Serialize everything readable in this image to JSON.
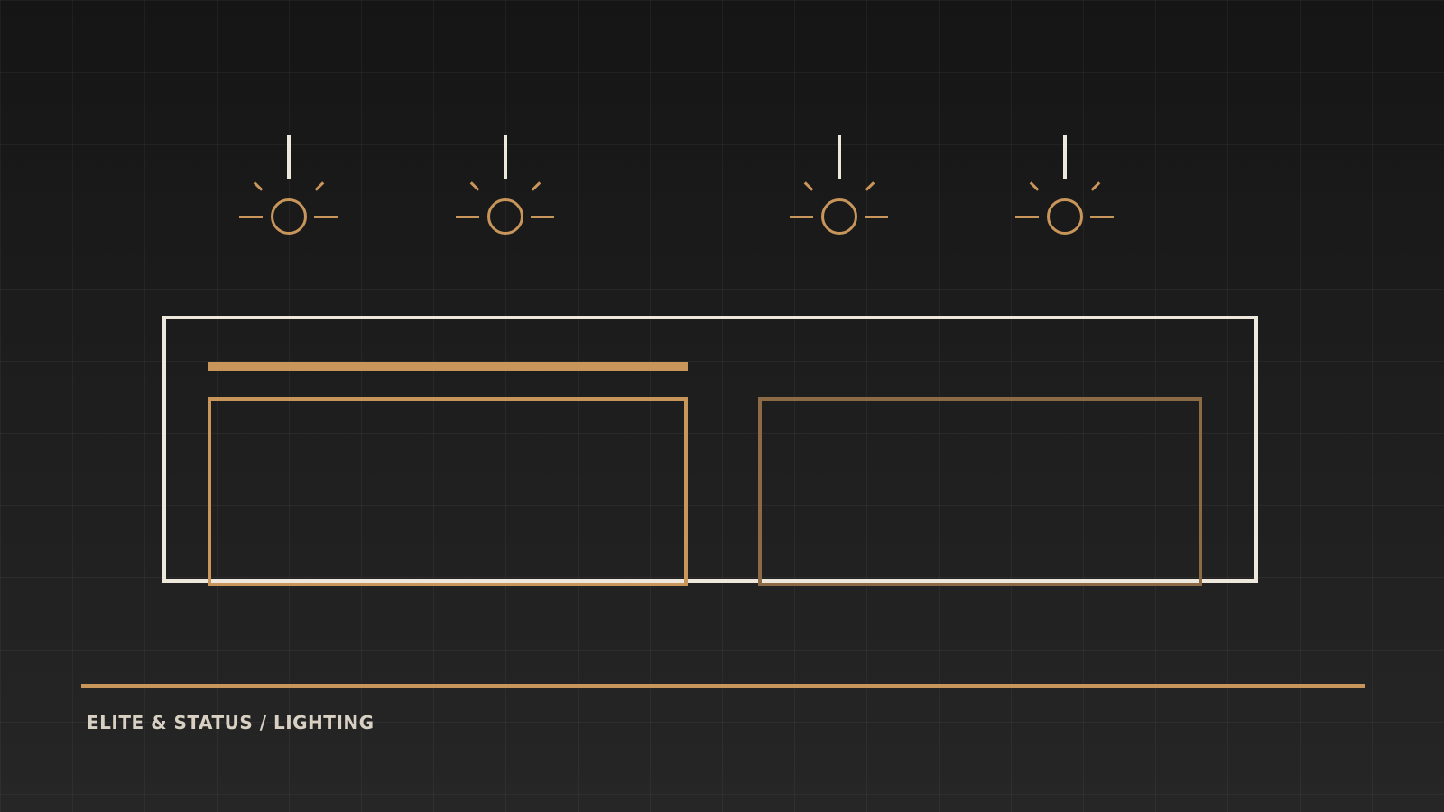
{
  "caption": "ELITE & STATUS / LIGHTING",
  "colors": {
    "accent": "#c8955b",
    "accent_dim": "#8c6a46",
    "outline": "#eee8dc",
    "background": "#1c1c1c"
  },
  "fixtures": [
    {
      "icon": "pendant-light-icon"
    },
    {
      "icon": "pendant-light-icon"
    },
    {
      "icon": "pendant-light-icon"
    },
    {
      "icon": "pendant-light-icon"
    }
  ]
}
